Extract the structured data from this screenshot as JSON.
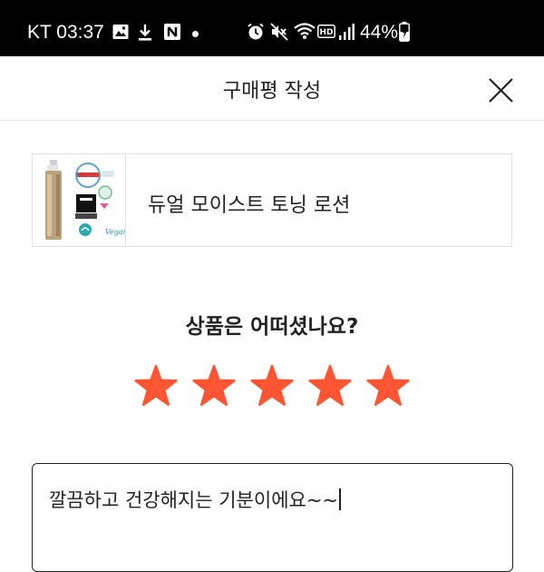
{
  "status_bar": {
    "carrier_time": "KT 03:37",
    "battery": "44%",
    "icons": [
      "image-icon",
      "download-icon",
      "naver-app-icon",
      "alarm-icon",
      "mute-icon",
      "wifi-icon",
      "hd-icon",
      "signal-icon",
      "battery-charging-icon"
    ]
  },
  "header": {
    "title": "구매평 작성",
    "close_icon": "close-icon"
  },
  "product": {
    "name": "듀얼 모이스트 토닝 로션"
  },
  "rating": {
    "question": "상품은 어떠셨나요?",
    "value": 5,
    "max": 5,
    "star_color": "#ff5532"
  },
  "review": {
    "text": "깔끔하고 건강해지는 기분이에요~~"
  }
}
